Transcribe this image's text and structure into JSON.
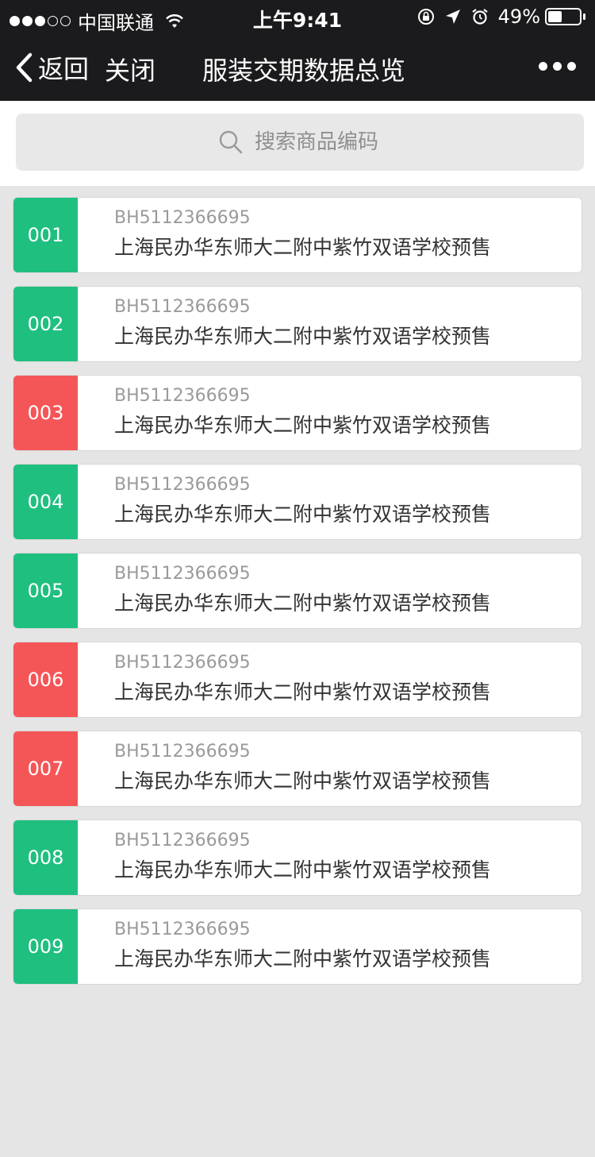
{
  "status": {
    "carrier": "中国联通",
    "time": "上午9:41",
    "battery": "49%",
    "battery_level": 0.49
  },
  "nav": {
    "back_label": "返回",
    "close_label": "关闭",
    "title": "服装交期数据总览"
  },
  "search": {
    "placeholder": "搜索商品编码"
  },
  "colors": {
    "green": "#1fbf80",
    "red": "#f45658",
    "nav_bg": "#1b1b1d"
  },
  "items": [
    {
      "index": "001",
      "code": "BH5112366695",
      "name": "上海民办华东师大二附中紫竹双语学校预售",
      "status": "green"
    },
    {
      "index": "002",
      "code": "BH5112366695",
      "name": "上海民办华东师大二附中紫竹双语学校预售",
      "status": "green"
    },
    {
      "index": "003",
      "code": "BH5112366695",
      "name": "上海民办华东师大二附中紫竹双语学校预售",
      "status": "red"
    },
    {
      "index": "004",
      "code": "BH5112366695",
      "name": "上海民办华东师大二附中紫竹双语学校预售",
      "status": "green"
    },
    {
      "index": "005",
      "code": "BH5112366695",
      "name": "上海民办华东师大二附中紫竹双语学校预售",
      "status": "green"
    },
    {
      "index": "006",
      "code": "BH5112366695",
      "name": "上海民办华东师大二附中紫竹双语学校预售",
      "status": "red"
    },
    {
      "index": "007",
      "code": "BH5112366695",
      "name": "上海民办华东师大二附中紫竹双语学校预售",
      "status": "red"
    },
    {
      "index": "008",
      "code": "BH5112366695",
      "name": "上海民办华东师大二附中紫竹双语学校预售",
      "status": "green"
    },
    {
      "index": "009",
      "code": "BH5112366695",
      "name": "上海民办华东师大二附中紫竹双语学校预售",
      "status": "green"
    }
  ]
}
